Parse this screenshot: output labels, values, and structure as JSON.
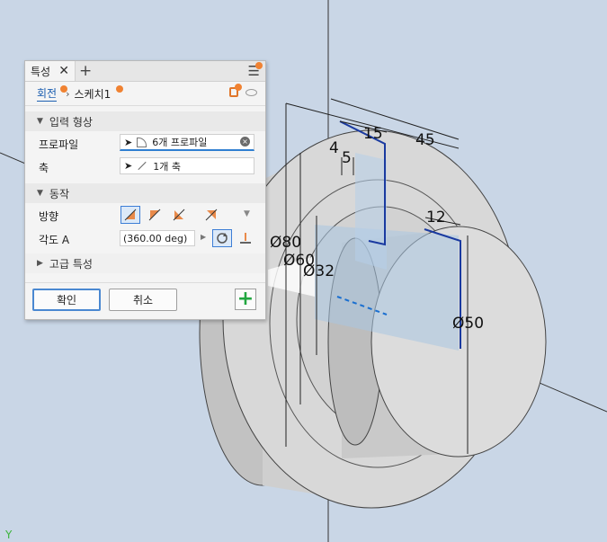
{
  "panel": {
    "tab_label": "특성",
    "close_glyph": "✕",
    "add_glyph": "+",
    "menu_glyph": "☰",
    "breadcrumb": {
      "parent": "회전",
      "separator": "›",
      "current": "스케치1"
    },
    "sections": {
      "input": "입력 형상",
      "behavior": "동작",
      "advanced": "고급 특성"
    },
    "profile": {
      "label": "프로파일",
      "value": "6개 프로파일"
    },
    "axis": {
      "label": "축",
      "value": "1개 축"
    },
    "direction": {
      "label": "방향"
    },
    "angle": {
      "label": "각도 A",
      "value": "(360.00 deg)"
    },
    "buttons": {
      "ok": "확인",
      "cancel": "취소"
    }
  },
  "dimensions": {
    "d15": "15",
    "d45": "45",
    "d4": "4",
    "d5": "5",
    "d12": "12",
    "d80": "Ø80",
    "d60": "Ø60",
    "d32": "Ø32",
    "d50": "Ø50"
  },
  "axis_indicator": "Y",
  "colors": {
    "accent": "#2f7fd1",
    "badge": "#f08232",
    "add": "#22a640"
  }
}
